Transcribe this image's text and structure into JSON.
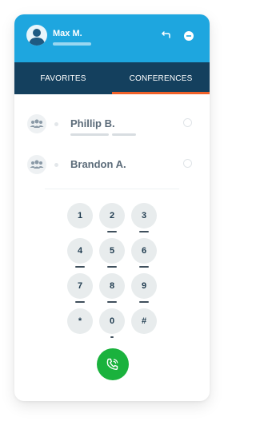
{
  "user": {
    "name": "Max M."
  },
  "header": {
    "icons": [
      "transfer-icon",
      "minimize-icon"
    ]
  },
  "tabs": [
    {
      "label": "FAVORITES",
      "active": false
    },
    {
      "label": "CONFERENCES",
      "active": true
    }
  ],
  "contacts": [
    {
      "name": "Phillip B.",
      "icon": "group-avatar-icon"
    },
    {
      "name": "Brandon A.",
      "icon": "group-avatar-icon"
    }
  ],
  "keypad": {
    "keys": [
      "1",
      "2",
      "3",
      "4",
      "5",
      "6",
      "7",
      "8",
      "9",
      "*",
      "0",
      "#"
    ]
  },
  "colors": {
    "header": "#1ea6df",
    "tabs": "#14405e",
    "active_tab_indicator": "#f0612a",
    "call_button": "#1ab23d"
  }
}
